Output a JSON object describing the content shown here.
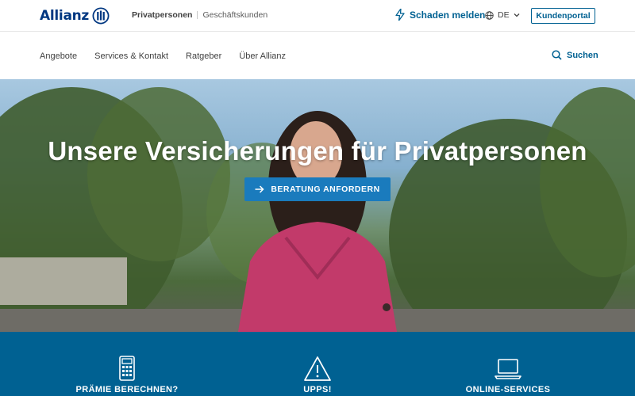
{
  "brand": {
    "name": "Allianz"
  },
  "topbar": {
    "segment_active": "Privatpersonen",
    "segment_inactive": "Geschäftskunden",
    "claim_label": "Schaden melden",
    "language": "DE",
    "portal_label": "Kundenportal"
  },
  "nav": {
    "items": [
      {
        "label": "Angebote"
      },
      {
        "label": "Services & Kontakt"
      },
      {
        "label": "Ratgeber"
      },
      {
        "label": "Über Allianz"
      }
    ],
    "search_label": "Suchen"
  },
  "hero": {
    "title": "Unsere Versicherungen für Privatpersonen",
    "cta_label": "BERATUNG ANFORDERN"
  },
  "services": [
    {
      "label": "PRÄMIE BERECHNEN?",
      "icon": "calculator-icon"
    },
    {
      "label": "UPPS!",
      "icon": "warning-icon"
    },
    {
      "label": "ONLINE-SERVICES",
      "icon": "laptop-icon"
    }
  ],
  "colors": {
    "brand_blue": "#003781",
    "accent_blue": "#006192",
    "cta_blue": "#1a7bbd",
    "hero_text": "#ffffff"
  }
}
